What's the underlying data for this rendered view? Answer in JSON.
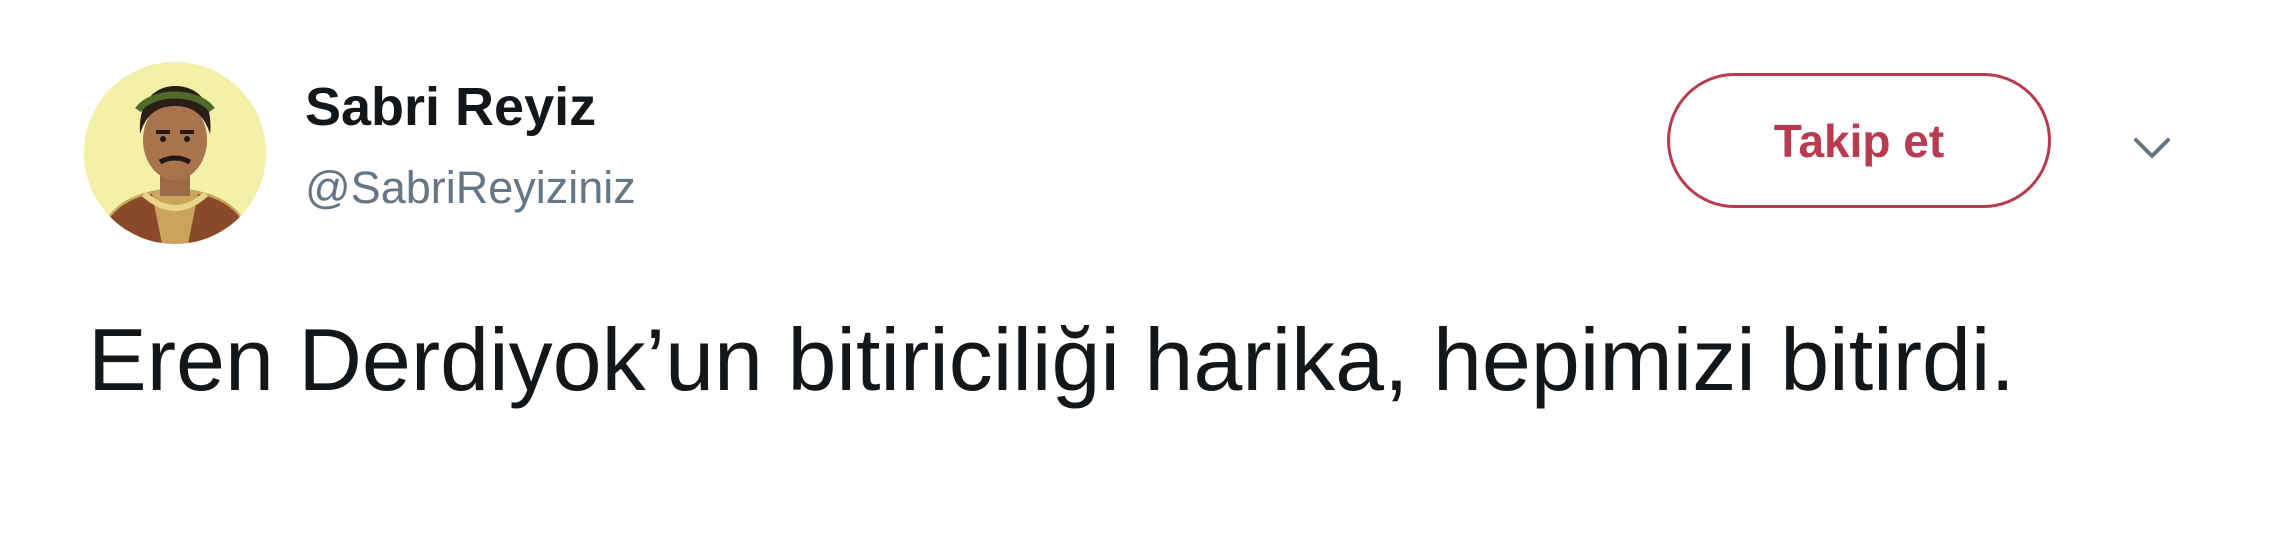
{
  "user": {
    "display_name": "Sabri Reyiz",
    "handle": "@SabriReyiziniz"
  },
  "follow_button": {
    "label": "Takip et",
    "color": "#b83b50"
  },
  "menu": {
    "icon": "chevron-down-icon"
  },
  "tweet": {
    "text": "Eren Derdiyok’un bitiriciliği harika, hepimizi bitirdi."
  }
}
